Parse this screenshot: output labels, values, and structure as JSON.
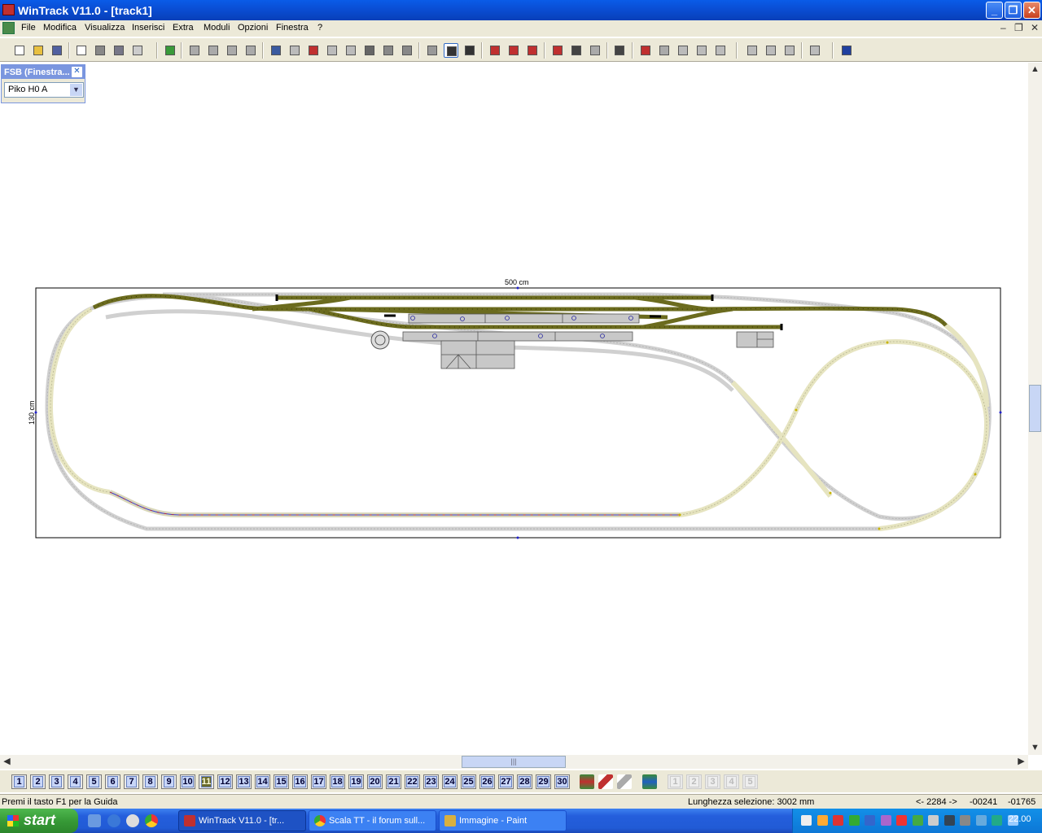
{
  "window": {
    "title": "WinTrack  V11.0 - [track1]",
    "btn_min": "_",
    "btn_max": "❐",
    "btn_close": "✕"
  },
  "menubar": {
    "items": [
      "File",
      "Modifica",
      "Visualizza",
      "Inserisci",
      "Extra",
      "Moduli",
      "Opzioni",
      "Finestra",
      "?"
    ],
    "mdi_min": "–",
    "mdi_restore": "❐",
    "mdi_close": "✕"
  },
  "toolbar": {
    "icons": [
      "new-icon",
      "open-icon",
      "save-icon",
      "print-preview-icon",
      "print-icon",
      "print-setup-icon",
      "page-setup-icon",
      "background-image-icon",
      "zoom-out-icon",
      "zoom-in-icon",
      "zoom-window-icon",
      "zoom-all-icon",
      "undo-icon",
      "redo-icon",
      "copy-layer-icon",
      "align-icon",
      "align-2-icon",
      "cut-icon",
      "copy-icon",
      "paste-icon",
      "flex-track-icon",
      "curve-track-icon",
      "straight-track-icon",
      "group-icon",
      "red-block-icon",
      "red-block-2-icon",
      "connect-icon",
      "insert-icon",
      "rotate-icon",
      "measure-icon",
      "switch-icon",
      "switch-2-icon",
      "join-icon",
      "split-icon",
      "transfer-icon",
      "height-icon",
      "height-2-icon",
      "height-3-icon",
      "explode-icon",
      "help-icon"
    ]
  },
  "fsb": {
    "title": "FSB (Finestra...",
    "close": "✕",
    "selected": "Piko H0  A"
  },
  "drawing": {
    "width_label": "500 cm",
    "height_label": "130 cm"
  },
  "layers": {
    "items": [
      "1",
      "2",
      "3",
      "4",
      "5",
      "6",
      "7",
      "8",
      "9",
      "10",
      "11",
      "12",
      "13",
      "14",
      "15",
      "16",
      "17",
      "18",
      "19",
      "20",
      "21",
      "22",
      "23",
      "24",
      "25",
      "26",
      "27",
      "28",
      "29",
      "30"
    ],
    "current": "11",
    "extra": [
      "1",
      "2",
      "3",
      "4",
      "5"
    ]
  },
  "statusbar": {
    "help": "Premi il tasto F1 per la Guida",
    "selection_length": "Lunghezza selezione:  3002 mm",
    "value": "<- 2284 ->",
    "x": "-00241",
    "y": "-01765"
  },
  "taskbar": {
    "start": "start",
    "tasks": [
      "WinTrack  V11.0 - [tr...",
      "Scala TT - il forum sull...",
      "Immagine - Paint"
    ],
    "clock": "22.00"
  },
  "colors": {
    "track_main": "#6b6b1e",
    "track_light": "#e6e4c4",
    "track_inactive": "#d4d4d4",
    "selection": "#4040d0",
    "building": "#c8c8c8"
  }
}
